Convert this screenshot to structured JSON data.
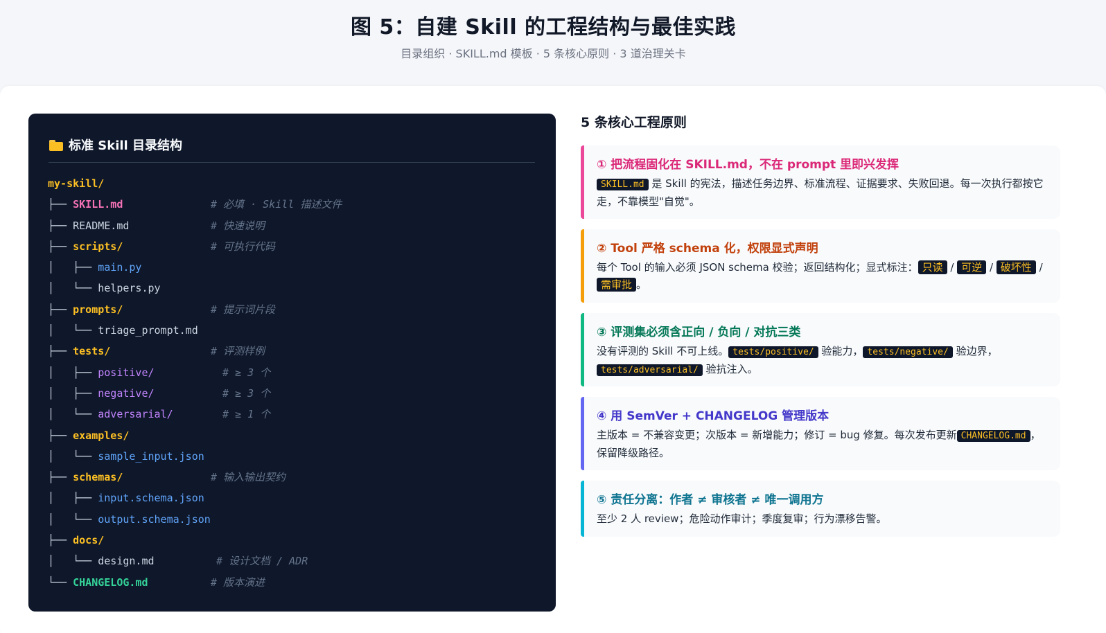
{
  "header": {
    "title": "图 5：自建 Skill 的工程结构与最佳实践",
    "subtitle": "目录组织 · SKILL.md 模板 · 5 条核心原则 · 3 道治理关卡"
  },
  "tree": {
    "title": "标准 Skill 目录结构",
    "rows": [
      {
        "prefix": "",
        "name": "my-skill/",
        "comment": ""
      },
      {
        "prefix": "├── ",
        "name": "SKILL.md",
        "comment": "# 必填 · Skill 描述文件"
      },
      {
        "prefix": "├── ",
        "name": "README.md",
        "comment": "# 快速说明"
      },
      {
        "prefix": "├── ",
        "name": "scripts/",
        "comment": "# 可执行代码"
      },
      {
        "prefix": "│   ├── ",
        "name": "main.py",
        "comment": ""
      },
      {
        "prefix": "│   └── ",
        "name": "helpers.py",
        "comment": ""
      },
      {
        "prefix": "├── ",
        "name": "prompts/",
        "comment": "# 提示词片段"
      },
      {
        "prefix": "│   └── ",
        "name": "triage_prompt.md",
        "comment": ""
      },
      {
        "prefix": "├── ",
        "name": "tests/",
        "comment": "# 评测样例"
      },
      {
        "prefix": "│   ├── ",
        "name": "positive/",
        "comment": "# ≥ 3 个"
      },
      {
        "prefix": "│   ├── ",
        "name": "negative/",
        "comment": "# ≥ 3 个"
      },
      {
        "prefix": "│   └── ",
        "name": "adversarial/",
        "comment": "# ≥ 1 个"
      },
      {
        "prefix": "├── ",
        "name": "examples/",
        "comment": ""
      },
      {
        "prefix": "│   └── ",
        "name": "sample_input.json",
        "comment": ""
      },
      {
        "prefix": "├── ",
        "name": "schemas/",
        "comment": "# 输入输出契约"
      },
      {
        "prefix": "│   ├── ",
        "name": "input.schema.json",
        "comment": ""
      },
      {
        "prefix": "│   └── ",
        "name": "output.schema.json",
        "comment": ""
      },
      {
        "prefix": "├── ",
        "name": "docs/",
        "comment": ""
      },
      {
        "prefix": "│   └── ",
        "name": "design.md",
        "comment": "# 设计文档 / ADR"
      },
      {
        "prefix": "└── ",
        "name": "CHANGELOG.md",
        "comment": "# 版本演进"
      }
    ]
  },
  "principles": {
    "section_title": "5 条核心工程原则",
    "p1": {
      "title": "① 把流程固化在 SKILL.md，不在 prompt 里即兴发挥",
      "code": "SKILL.md",
      "text_a": " 是 Skill 的宪法，描述任务边界、标准流程、证据要求、失败回退。每一次执行都按它走，不靠模型\"自觉\"。",
      "color": "#db2777"
    },
    "p2": {
      "title": "② Tool 严格 schema 化，权限显式声明",
      "text_a": "每个 Tool 的输入必须 JSON schema 校验；返回结构化；显式标注：",
      "tag1": "只读",
      "tag2": "可逆",
      "tag3": "破坏性",
      "tag4": "需审批",
      "sep": " / ",
      "end": "。",
      "color": "#f59e0b",
      "title_color": "#c2410c"
    },
    "p3": {
      "title": "③ 评测集必须含正向 / 负向 / 对抗三类",
      "text_a": "没有评测的 Skill 不可上线。",
      "code1": "tests/positive/",
      "text_b": " 验能力，",
      "code2": "tests/negative/",
      "text_c": " 验边界，",
      "code3": "tests/adversarial/",
      "text_d": " 验抗注入。",
      "color": "#10b981",
      "title_color": "#047857"
    },
    "p4": {
      "title": "④ 用 SemVer + CHANGELOG 管理版本",
      "text_a": "主版本 = 不兼容变更；次版本 = 新增能力；修订 = bug 修复。每次发布更新",
      "code": "CHANGELOG.md",
      "text_b": "，保留降级路径。",
      "color": "#6366f1",
      "title_color": "#4338ca"
    },
    "p5": {
      "title": "⑤ 责任分离：作者 ≠ 审核者 ≠ 唯一调用方",
      "text_a": "至少 2 人 review；危险动作审计；季度复审；行为漂移告警。",
      "color": "#06b6d4",
      "title_color": "#0e7490"
    }
  }
}
